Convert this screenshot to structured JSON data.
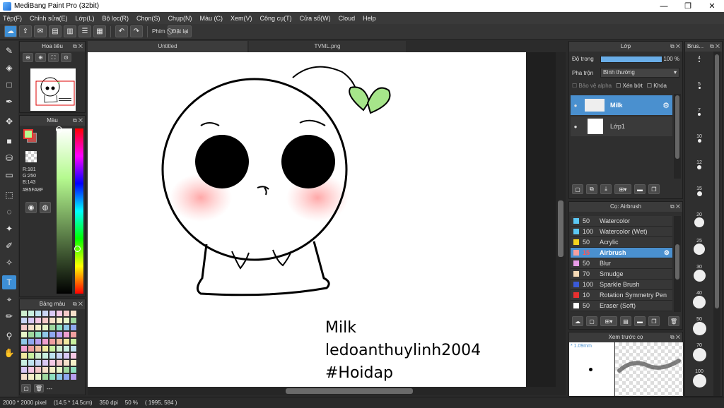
{
  "window": {
    "title": "MediBang Paint Pro (32bit)",
    "minimize": "—",
    "maximize": "❐",
    "close": "✕"
  },
  "menu": [
    "Tệp(F)",
    "Chỉnh sửa(E)",
    "Lớp(L)",
    "Bộ lọc(R)",
    "Chọn(S)",
    "Chụp(N)",
    "Màu (C)",
    "Xem(V)",
    "Công cụ(T)",
    "Cửa sổ(W)",
    "Cloud",
    "Help"
  ],
  "toolbar": {
    "phim_label": "Phím",
    "reset_label": "Đặt lại"
  },
  "tabs": {
    "untitled": "Untitled",
    "file": "TVML.png"
  },
  "navigator": {
    "title": "Hoa tiêu"
  },
  "color_panel": {
    "title": "Màu",
    "r": "R:181",
    "g": "G:250",
    "b": "B:143",
    "hex": "#B5FA8F",
    "fg": "#b5fa8f",
    "bg": "#c0504d"
  },
  "palette": {
    "title": "Bảng màu",
    "more": "---"
  },
  "layers": {
    "title": "Lớp",
    "opacity_label": "Độ trong",
    "opacity_value": "100 %",
    "opacity_fraction": 1.0,
    "blend_label": "Pha trộn",
    "blend_value": "Bình thường",
    "protect_alpha": "Bảo vệ alpha",
    "clipping": "Xén bớt",
    "lock": "Khóa",
    "items": [
      {
        "name": "Milk",
        "selected": true
      },
      {
        "name": "Lớp1",
        "selected": false
      }
    ]
  },
  "brush_panel": {
    "title": "Cọ: Airbrush",
    "items": [
      {
        "size": "50",
        "name": "Watercolor",
        "color": "#5bc8f5",
        "selected": false
      },
      {
        "size": "100",
        "name": "Watercolor (Wet)",
        "color": "#5bc8f5",
        "selected": false
      },
      {
        "size": "50",
        "name": "Acrylic",
        "color": "#f5d31e",
        "selected": false
      },
      {
        "size": "15",
        "name": "Airbrush",
        "color": "#f5a0a0",
        "selected": true
      },
      {
        "size": "50",
        "name": "Blur",
        "color": "#e89ce8",
        "selected": false
      },
      {
        "size": "70",
        "name": "Smudge",
        "color": "#f5d9b5",
        "selected": false
      },
      {
        "size": "100",
        "name": "Sparkle Brush",
        "color": "#3a5ad8",
        "selected": false
      },
      {
        "size": "10",
        "name": "Rotation Symmetry Pen",
        "color": "#e83030",
        "selected": false
      },
      {
        "size": "50",
        "name": "Eraser (Soft)",
        "color": "#ffffff",
        "selected": false
      }
    ]
  },
  "brush_preview": {
    "title": "Xem trước cọ",
    "size": "* 1.09mm"
  },
  "brush_size_panel": {
    "title": "Brus...",
    "sizes": [
      "4",
      "5",
      "7",
      "10",
      "12",
      "15",
      "20",
      "25",
      "30",
      "40",
      "50",
      "70",
      "100"
    ]
  },
  "canvas_text": {
    "line1": "Milk",
    "line2": "ledoanthuylinh2004",
    "line3": "#Hoidap"
  },
  "status": {
    "size": "2000 * 2000 pixel",
    "cm": "(14.5 * 14.5cm)",
    "dpi": "350 dpi",
    "zoom": "50 %",
    "coords": "( 1995, 584 )"
  }
}
